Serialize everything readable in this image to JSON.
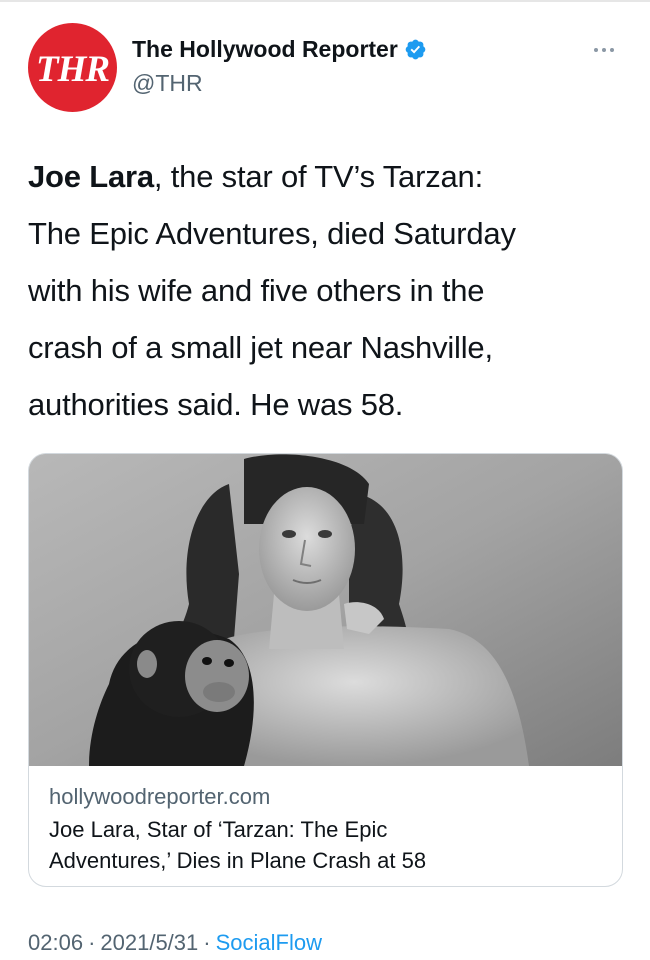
{
  "author": {
    "avatar_text": "THR",
    "display_name": "The Hollywood Reporter",
    "handle": "@THR",
    "verified": true
  },
  "tweet": {
    "bold_text": "Joe Lara",
    "text_line1_rest": ", the star of TV’s Tarzan:",
    "text_line2": "The Epic Adventures, died Saturday",
    "text_line3": "with his wife and five others in the",
    "text_line4": "crash of a small jet near Nashville,",
    "text_line5": "authorities said. He was 58."
  },
  "card": {
    "domain": "hollywoodreporter.com",
    "title_line1": "Joe Lara, Star of ‘Tarzan: The Epic",
    "title_line2": "Adventures,’ Dies in Plane Crash at 58"
  },
  "meta": {
    "time": "02:06",
    "date": "2021/5/31",
    "separator": "·",
    "source": "SocialFlow"
  },
  "icons": {
    "verified": "verified-badge-icon",
    "more": "more-horizontal-icon"
  },
  "colors": {
    "brand_red": "#e0242f",
    "link_blue": "#1d9bf0",
    "secondary_text": "#536471",
    "verified_blue": "#1d9bf0"
  }
}
